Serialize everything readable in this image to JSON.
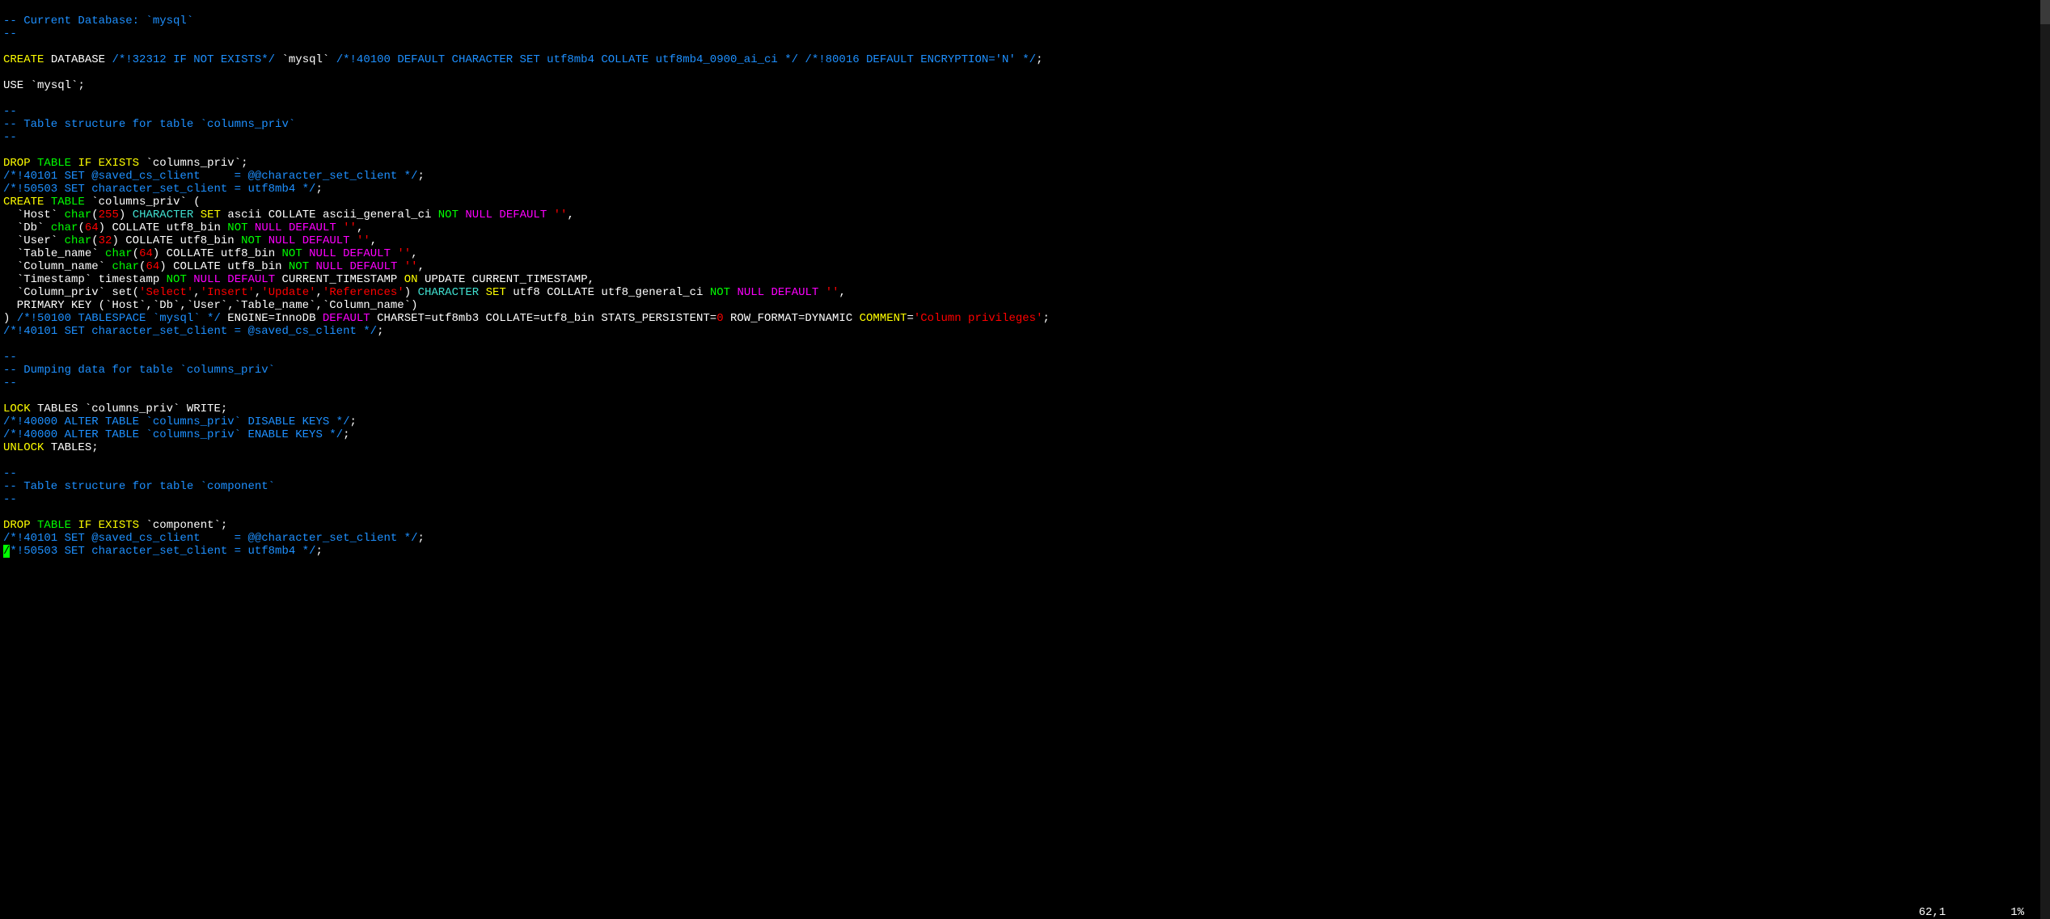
{
  "status": {
    "position": "62,1",
    "percent": "1%"
  },
  "tokens": {
    "dashdash": "--",
    "comment_currentdb": "-- Current Database: `mysql`",
    "CREATE": "CREATE",
    "DATABASE": "DATABASE",
    "vc32312": "/*!32312 IF NOT EXISTS*/",
    "backtick_mysql": "`mysql`",
    "vc40100": "/*!40100 DEFAULT CHARACTER SET utf8mb4 COLLATE utf8mb4_0900_ai_ci */",
    "vc80016": "/*!80016 DEFAULT ENCRYPTION='N' */",
    "semi": ";",
    "USE": "USE",
    "comment_tblstruct_columns": "-- Table structure for table `columns_priv`",
    "DROP": "DROP",
    "TABLE": "TABLE",
    "IF": "IF",
    "EXISTS": "EXISTS",
    "backtick_columns_priv": "`columns_priv`",
    "vc40101_save": "/*!40101 SET @saved_cs_client     = @@character_set_client */",
    "vc50503": "/*!50503 SET character_set_client = utf8mb4 */",
    "lparen": " (",
    "indent": "  ",
    "bHost": "`Host`",
    "char_kw": "char",
    "n255": "255",
    "n64": "64",
    "n32": "32",
    "rparen": ")",
    "CHARACTER": "CHARACTER",
    "SET": "SET",
    "ascii_collate": " ascii COLLATE ascii_general_ci ",
    "NOT": "NOT",
    "NULL": "NULL",
    "DEFAULT": "DEFAULT",
    "emptystr": "''",
    "comma": ",",
    "bDb": "`Db`",
    "collate_utf8bin": " COLLATE utf8_bin ",
    "bUser": "`User`",
    "bTable_name": "`Table_name`",
    "bColumn_name": "`Column_name`",
    "bTimestamp": "`Timestamp`",
    "timestamp_word": " timestamp ",
    "current_ts": " CURRENT_TIMESTAMP ",
    "ON": "ON",
    "update_current": " UPDATE CURRENT_TIMESTAMP,",
    "bColumn_priv": "`Column_priv`",
    "set_kw": " set",
    "str_select": "'Select'",
    "str_insert": "'Insert'",
    "str_update": "'Update'",
    "str_references": "'References'",
    "utf8_collate_gen": " utf8 COLLATE utf8_general_ci ",
    "primary_key_line": "  PRIMARY KEY (`Host`,`Db`,`User`,`Table_name`,`Column_name`)",
    "close_paren": ") ",
    "vc50100_tablespace": "/*!50100 TABLESPACE `mysql` */",
    "engine_innodb": " ENGINE=InnoDB ",
    "charset_tail": " CHARSET=utf8mb3 COLLATE=utf8_bin STATS_PERSISTENT=",
    "zero": "0",
    "rowformat": " ROW_FORMAT=DYNAMIC ",
    "COMMENT": "COMMENT",
    "eq": "=",
    "str_colpriv": "'Column privileges'",
    "vc40101_restore": "/*!40101 SET character_set_client = @saved_cs_client */",
    "comment_dumping": "-- Dumping data for table `columns_priv`",
    "LOCK": "LOCK",
    "tables_write": " TABLES `columns_priv` WRITE;",
    "vc40000_disable": "/*!40000 ALTER TABLE `columns_priv` DISABLE KEYS */",
    "vc40000_enable": "/*!40000 ALTER TABLE `columns_priv` ENABLE KEYS */",
    "UNLOCK": "UNLOCK",
    "tables_semi": " TABLES;",
    "comment_tblstruct_component": "-- Table structure for table `component`",
    "backtick_component": "`component`",
    "cursor_slash": "/",
    "vc50503_tail": "*!50503 SET character_set_client = utf8mb4 */"
  }
}
